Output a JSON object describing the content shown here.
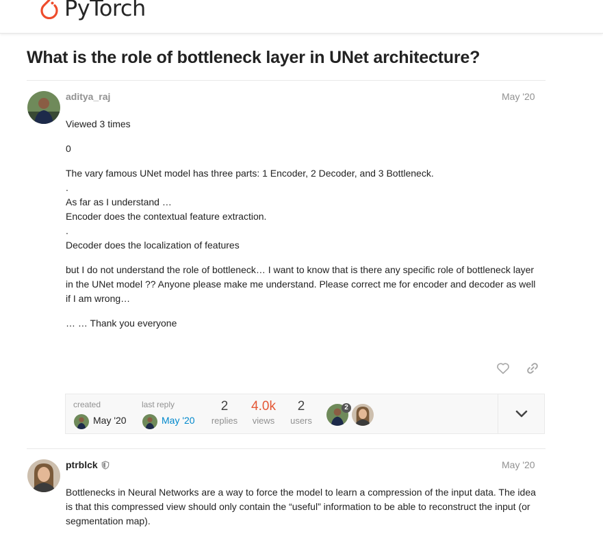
{
  "header": {
    "logo_text": "PyTorch"
  },
  "topic": {
    "title": "What is the role of bottleneck layer in UNet architecture?"
  },
  "post1": {
    "username": "aditya_raj",
    "date": "May '20",
    "paragraphs": [
      "Viewed 3 times",
      "0",
      "The vary famous UNet model has three parts: 1 Encoder, 2 Decoder, and 3 Bottleneck.\n.\nAs far as I understand …\nEncoder does the contextual feature extraction.\n.\nDecoder does the localization of features",
      "but I do not understand the role of bottleneck… I want to know that is there any specific role of bottleneck layer in the UNet model ?? Anyone please make me understand. Please correct me for encoder and decoder as well if I am wrong…",
      "… … Thank you everyone"
    ]
  },
  "topic_map": {
    "created_label": "created",
    "created_date": "May '20",
    "last_reply_label": "last reply",
    "last_reply_date": "May '20",
    "replies_count": "2",
    "replies_label": "replies",
    "views_count": "4.0k",
    "views_label": "views",
    "users_count": "2",
    "users_label": "users",
    "participant_badge": "2",
    "views_color": "#e45735",
    "link_color": "#0088cc"
  },
  "post2": {
    "username": "ptrblck",
    "date": "May '20",
    "body": "Bottlenecks in Neural Networks are a way to force the model to learn a compression of the input data. The idea is that this compressed view should only contain the “useful” information to be able to reconstruct the input (or segmentation map)."
  },
  "icons": {
    "logo": "pytorch-flame-icon",
    "like": "heart-icon",
    "share": "link-icon",
    "expand": "chevron-down-icon",
    "moderator": "shield-icon"
  }
}
